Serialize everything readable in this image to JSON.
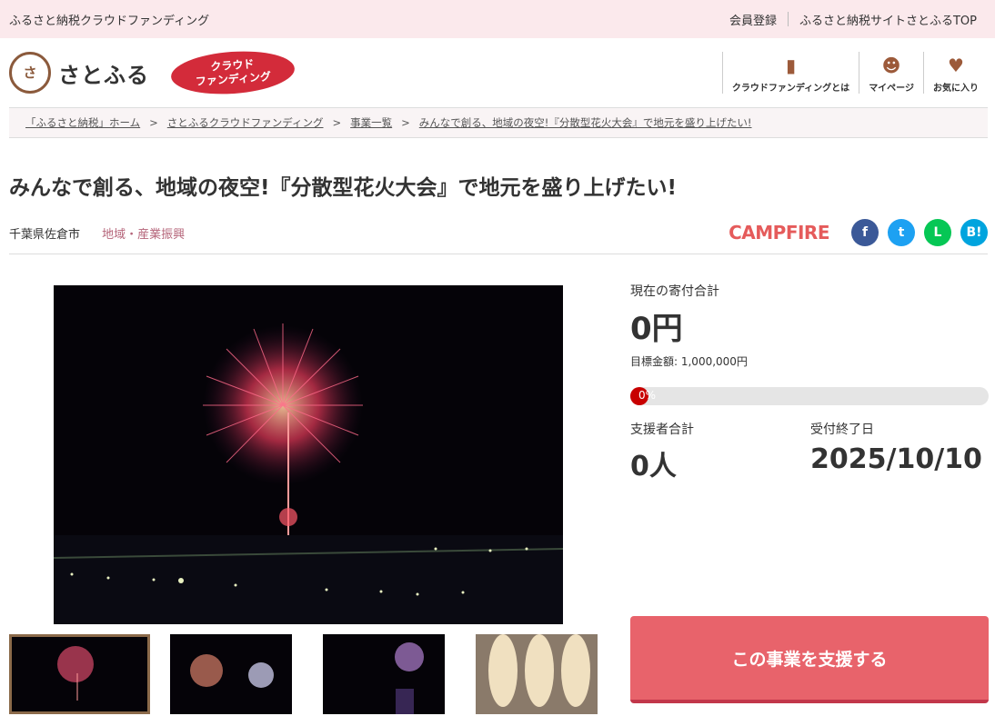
{
  "topbar": {
    "site_title": "ふるさと納税クラウドファンディング",
    "register": "会員登録",
    "top_link": "ふるさと納税サイトさとふるTOP"
  },
  "header": {
    "logo_seal": "さと ふる",
    "logo_text": "さとふる",
    "cf_badge_line1": "クラウド",
    "cf_badge_line2": "ファンディング",
    "nav": [
      {
        "label": "クラウドファンディングとは",
        "icon": "bookmark-icon"
      },
      {
        "label": "マイページ",
        "icon": "user-icon"
      },
      {
        "label": "お気に入り",
        "icon": "heart-icon"
      }
    ]
  },
  "breadcrumb": [
    "「ふるさと納税」ホーム",
    "さとふるクラウドファンディング",
    "事業一覧",
    "みんなで創る、地域の夜空!『分散型花火大会』で地元を盛り上げたい!"
  ],
  "breadcrumb_sep": ">",
  "project": {
    "title": "みんなで創る、地域の夜空!『分散型花火大会』で地元を盛り上げたい!",
    "location": "千葉県佐倉市",
    "category": "地域・産業振興",
    "partner": "CAMPFIRE",
    "sns": [
      {
        "label": "f",
        "color": "#3b5998",
        "icon": "facebook-icon"
      },
      {
        "label": "t",
        "color": "#1da1f2",
        "icon": "twitter-icon"
      },
      {
        "label": "L",
        "color": "#06c755",
        "icon": "line-icon"
      },
      {
        "label": "B!",
        "color": "#00a4de",
        "icon": "hatena-bookmark-icon"
      }
    ]
  },
  "stats": {
    "total_label": "現在の寄付合計",
    "total_value": "0円",
    "goal": "目標金額: 1,000,000円",
    "progress_label": "0%",
    "progress": 0,
    "supporters_label": "支援者合計",
    "supporters_value": "0人",
    "deadline_label": "受付終了日",
    "deadline_value": "2025/10/10"
  },
  "support_button": "この事業を支援する",
  "colors": {
    "topbar_bg": "#fbe9ec",
    "accent": "#d32b3a",
    "button": "#e8636b",
    "category": "#b5657a"
  }
}
